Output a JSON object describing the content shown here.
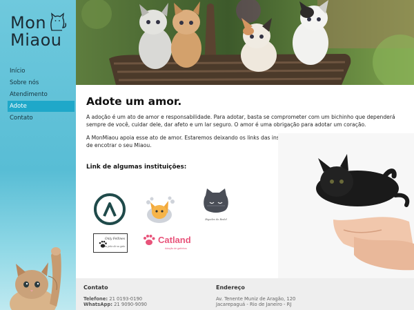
{
  "brand": {
    "line1": "Mon",
    "line2": "Miaou"
  },
  "nav": {
    "items": [
      {
        "label": "Início"
      },
      {
        "label": "Sobre nós"
      },
      {
        "label": "Atendimento"
      },
      {
        "label": "Adote"
      },
      {
        "label": "Contato"
      }
    ],
    "active_index": 3
  },
  "main": {
    "title": "Adote um amor.",
    "paragraph1": "A adoção é um ato de amor e responsabilidade. Para adotar, basta se comprometer com um bichinho que dependerá sempre de você, cuidar dele, dar afeto e um lar seguro. O amor é uma obrigação para adotar um coração.",
    "paragraph2": "A MonMiaou apoia esse ato de amor. Estaremos deixando os links das instituições que apoiam e te ajuda nesse processo de encotrar o seu Miaou.",
    "institutions_heading": "Link de algumas instituições:"
  },
  "institutions": {
    "inst3_caption": "Bigodes do Bedel",
    "inst4_name": "Only Fellines",
    "inst4_caption": "tu jeito de su gato",
    "inst5_name": "Catland",
    "inst5_caption": "Adoção de gatinhos"
  },
  "footer": {
    "contact_heading": "Contato",
    "phone_label": "Telefone:",
    "phone_value": "21 0193-0190",
    "whatsapp_label": "WhatsApp:",
    "whatsapp_value": "21 9090-9090",
    "address_heading": "Endereço",
    "address_line1": "Av. Tenente Muniz de Aragão, 120",
    "address_line2": "Jacarepaguá - Rio de Janeiro - RJ"
  },
  "colors": {
    "sidebar": "#58bdd5",
    "nav_active": "#1fa8c9",
    "footer_bg": "#eeeeee",
    "catland_pink": "#e8537a"
  }
}
